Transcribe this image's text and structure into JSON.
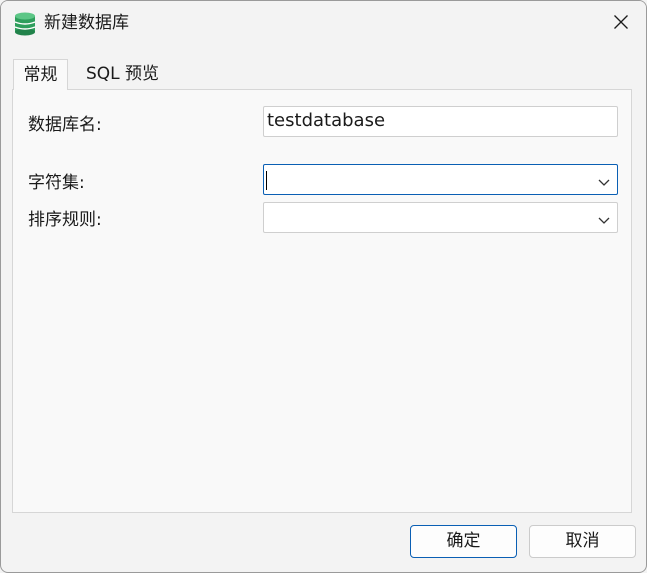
{
  "window": {
    "title": "新建数据库"
  },
  "tabs": [
    {
      "label": "常规"
    },
    {
      "label": "SQL 预览"
    }
  ],
  "form": {
    "db_name_label": "数据库名:",
    "db_name_value": "testdatabase",
    "charset_label": "字符集:",
    "charset_value": "",
    "collation_label": "排序规则:",
    "collation_value": ""
  },
  "buttons": {
    "ok": "确定",
    "cancel": "取消"
  },
  "icons": {
    "app": "database-icon",
    "close": "close-icon",
    "dropdown": "chevron-down-icon"
  },
  "colors": {
    "accent": "#0a5fb4",
    "db_icon": "#2e9e5c"
  }
}
